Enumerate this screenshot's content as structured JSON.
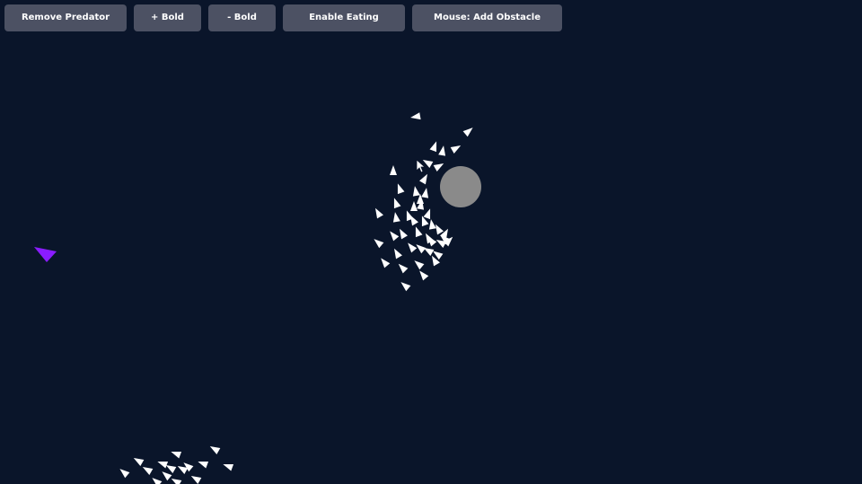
{
  "toolbar": {
    "remove_predator_label": "Remove Predator",
    "plus_bold_label": "+ Bold",
    "minus_bold_label": "- Bold",
    "enable_eating_label": "Enable Eating",
    "mouse_mode_label": "Mouse: Add Obstacle"
  },
  "colors": {
    "background": "#0a152a",
    "button_bg": "#4c5163",
    "button_text": "#ffffff",
    "boid": "#ffffff",
    "predator": "#8a1cff",
    "obstacle": "#8a8a8a"
  },
  "icons": {
    "boid": "white-triangle-icon",
    "predator": "purple-triangle-icon",
    "obstacle": "gray-circle",
    "cursor": "mouse-pointer-icon"
  }
}
